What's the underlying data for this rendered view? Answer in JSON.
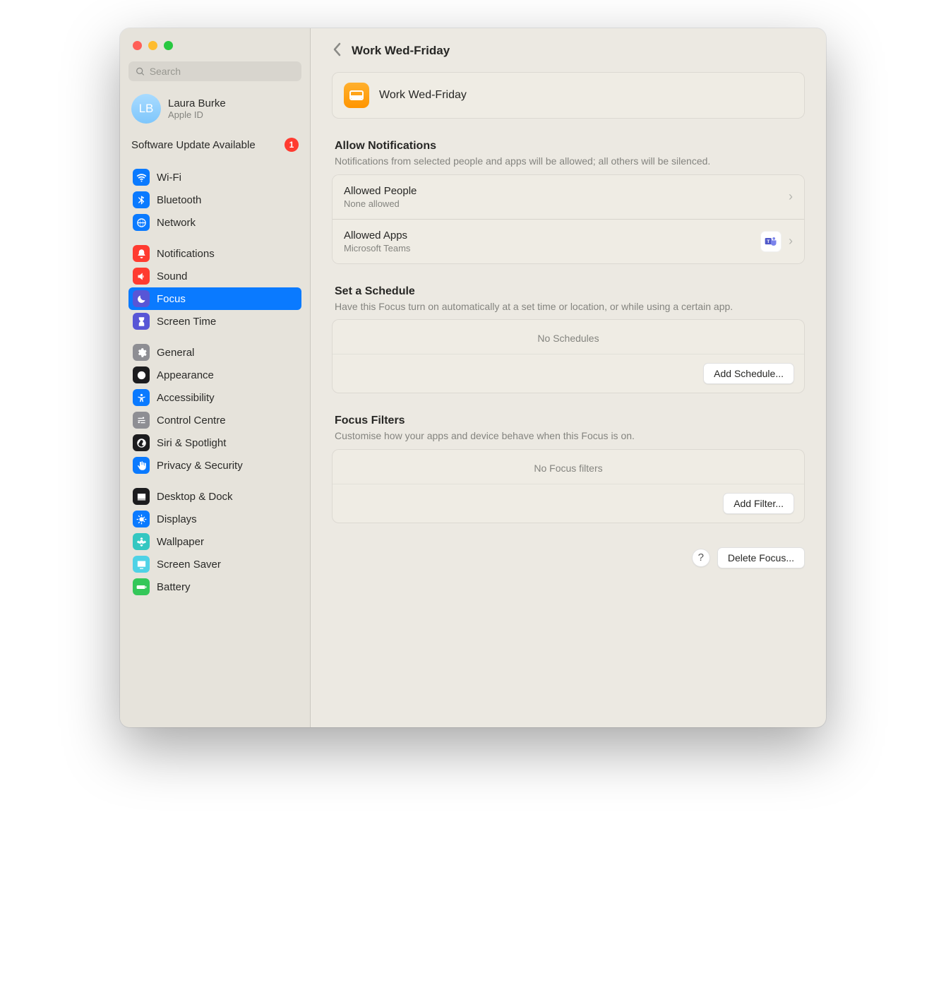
{
  "search": {
    "placeholder": "Search"
  },
  "account": {
    "initials": "LB",
    "name": "Laura Burke",
    "sub": "Apple ID"
  },
  "update": {
    "label": "Software Update Available",
    "count": "1"
  },
  "sidebar": {
    "group1": [
      {
        "label": "Wi-Fi",
        "color": "#0a7aff",
        "icon": "wifi"
      },
      {
        "label": "Bluetooth",
        "color": "#0a7aff",
        "icon": "bluetooth"
      },
      {
        "label": "Network",
        "color": "#0a7aff",
        "icon": "globe"
      }
    ],
    "group2": [
      {
        "label": "Notifications",
        "color": "#ff3b30",
        "icon": "bell"
      },
      {
        "label": "Sound",
        "color": "#ff3b30",
        "icon": "speaker"
      },
      {
        "label": "Focus",
        "color": "#5856d6",
        "icon": "moon"
      },
      {
        "label": "Screen Time",
        "color": "#5856d6",
        "icon": "hourglass"
      }
    ],
    "group3": [
      {
        "label": "General",
        "color": "#8e8e93",
        "icon": "gear"
      },
      {
        "label": "Appearance",
        "color": "#1c1c1e",
        "icon": "appearance"
      },
      {
        "label": "Accessibility",
        "color": "#0a7aff",
        "icon": "accessibility"
      },
      {
        "label": "Control Centre",
        "color": "#8e8e93",
        "icon": "sliders"
      },
      {
        "label": "Siri & Spotlight",
        "color": "#1c1c1e",
        "icon": "siri"
      },
      {
        "label": "Privacy & Security",
        "color": "#0a7aff",
        "icon": "hand"
      }
    ],
    "group4": [
      {
        "label": "Desktop & Dock",
        "color": "#1c1c1e",
        "icon": "dock"
      },
      {
        "label": "Displays",
        "color": "#0a7aff",
        "icon": "sun"
      },
      {
        "label": "Wallpaper",
        "color": "#34c7c1",
        "icon": "flower"
      },
      {
        "label": "Screen Saver",
        "color": "#4fd2e6",
        "icon": "screensaver"
      },
      {
        "label": "Battery",
        "color": "#34c759",
        "icon": "battery"
      }
    ]
  },
  "header": {
    "title": "Work Wed-Friday"
  },
  "focusCard": {
    "label": "Work Wed-Friday"
  },
  "notifications": {
    "title": "Allow Notifications",
    "desc": "Notifications from selected people and apps will be allowed; all others will be silenced.",
    "people": {
      "title": "Allowed People",
      "sub": "None allowed"
    },
    "apps": {
      "title": "Allowed Apps",
      "sub": "Microsoft Teams"
    }
  },
  "schedule": {
    "title": "Set a Schedule",
    "desc": "Have this Focus turn on automatically at a set time or location, or while using a certain app.",
    "empty": "No Schedules",
    "button": "Add Schedule..."
  },
  "filters": {
    "title": "Focus Filters",
    "desc": "Customise how your apps and device behave when this Focus is on.",
    "empty": "No Focus filters",
    "button": "Add Filter..."
  },
  "footer": {
    "help": "?",
    "delete": "Delete Focus..."
  }
}
